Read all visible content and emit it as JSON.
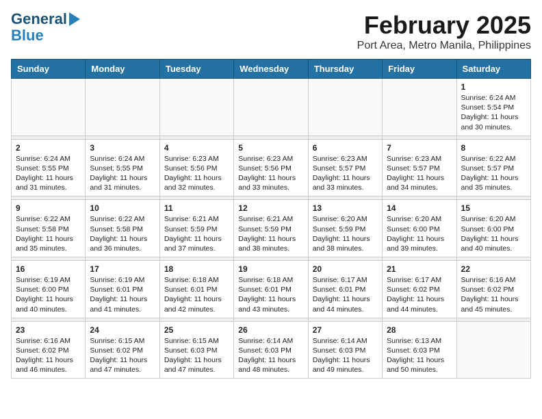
{
  "header": {
    "logo_line1": "General",
    "logo_line2": "Blue",
    "month": "February 2025",
    "location": "Port Area, Metro Manila, Philippines"
  },
  "days_of_week": [
    "Sunday",
    "Monday",
    "Tuesday",
    "Wednesday",
    "Thursday",
    "Friday",
    "Saturday"
  ],
  "weeks": [
    [
      {
        "day": "",
        "text": ""
      },
      {
        "day": "",
        "text": ""
      },
      {
        "day": "",
        "text": ""
      },
      {
        "day": "",
        "text": ""
      },
      {
        "day": "",
        "text": ""
      },
      {
        "day": "",
        "text": ""
      },
      {
        "day": "1",
        "text": "Sunrise: 6:24 AM\nSunset: 5:54 PM\nDaylight: 11 hours\nand 30 minutes."
      }
    ],
    [
      {
        "day": "2",
        "text": "Sunrise: 6:24 AM\nSunset: 5:55 PM\nDaylight: 11 hours\nand 31 minutes."
      },
      {
        "day": "3",
        "text": "Sunrise: 6:24 AM\nSunset: 5:55 PM\nDaylight: 11 hours\nand 31 minutes."
      },
      {
        "day": "4",
        "text": "Sunrise: 6:23 AM\nSunset: 5:56 PM\nDaylight: 11 hours\nand 32 minutes."
      },
      {
        "day": "5",
        "text": "Sunrise: 6:23 AM\nSunset: 5:56 PM\nDaylight: 11 hours\nand 33 minutes."
      },
      {
        "day": "6",
        "text": "Sunrise: 6:23 AM\nSunset: 5:57 PM\nDaylight: 11 hours\nand 33 minutes."
      },
      {
        "day": "7",
        "text": "Sunrise: 6:23 AM\nSunset: 5:57 PM\nDaylight: 11 hours\nand 34 minutes."
      },
      {
        "day": "8",
        "text": "Sunrise: 6:22 AM\nSunset: 5:57 PM\nDaylight: 11 hours\nand 35 minutes."
      }
    ],
    [
      {
        "day": "9",
        "text": "Sunrise: 6:22 AM\nSunset: 5:58 PM\nDaylight: 11 hours\nand 35 minutes."
      },
      {
        "day": "10",
        "text": "Sunrise: 6:22 AM\nSunset: 5:58 PM\nDaylight: 11 hours\nand 36 minutes."
      },
      {
        "day": "11",
        "text": "Sunrise: 6:21 AM\nSunset: 5:59 PM\nDaylight: 11 hours\nand 37 minutes."
      },
      {
        "day": "12",
        "text": "Sunrise: 6:21 AM\nSunset: 5:59 PM\nDaylight: 11 hours\nand 38 minutes."
      },
      {
        "day": "13",
        "text": "Sunrise: 6:20 AM\nSunset: 5:59 PM\nDaylight: 11 hours\nand 38 minutes."
      },
      {
        "day": "14",
        "text": "Sunrise: 6:20 AM\nSunset: 6:00 PM\nDaylight: 11 hours\nand 39 minutes."
      },
      {
        "day": "15",
        "text": "Sunrise: 6:20 AM\nSunset: 6:00 PM\nDaylight: 11 hours\nand 40 minutes."
      }
    ],
    [
      {
        "day": "16",
        "text": "Sunrise: 6:19 AM\nSunset: 6:00 PM\nDaylight: 11 hours\nand 40 minutes."
      },
      {
        "day": "17",
        "text": "Sunrise: 6:19 AM\nSunset: 6:01 PM\nDaylight: 11 hours\nand 41 minutes."
      },
      {
        "day": "18",
        "text": "Sunrise: 6:18 AM\nSunset: 6:01 PM\nDaylight: 11 hours\nand 42 minutes."
      },
      {
        "day": "19",
        "text": "Sunrise: 6:18 AM\nSunset: 6:01 PM\nDaylight: 11 hours\nand 43 minutes."
      },
      {
        "day": "20",
        "text": "Sunrise: 6:17 AM\nSunset: 6:01 PM\nDaylight: 11 hours\nand 44 minutes."
      },
      {
        "day": "21",
        "text": "Sunrise: 6:17 AM\nSunset: 6:02 PM\nDaylight: 11 hours\nand 44 minutes."
      },
      {
        "day": "22",
        "text": "Sunrise: 6:16 AM\nSunset: 6:02 PM\nDaylight: 11 hours\nand 45 minutes."
      }
    ],
    [
      {
        "day": "23",
        "text": "Sunrise: 6:16 AM\nSunset: 6:02 PM\nDaylight: 11 hours\nand 46 minutes."
      },
      {
        "day": "24",
        "text": "Sunrise: 6:15 AM\nSunset: 6:02 PM\nDaylight: 11 hours\nand 47 minutes."
      },
      {
        "day": "25",
        "text": "Sunrise: 6:15 AM\nSunset: 6:03 PM\nDaylight: 11 hours\nand 47 minutes."
      },
      {
        "day": "26",
        "text": "Sunrise: 6:14 AM\nSunset: 6:03 PM\nDaylight: 11 hours\nand 48 minutes."
      },
      {
        "day": "27",
        "text": "Sunrise: 6:14 AM\nSunset: 6:03 PM\nDaylight: 11 hours\nand 49 minutes."
      },
      {
        "day": "28",
        "text": "Sunrise: 6:13 AM\nSunset: 6:03 PM\nDaylight: 11 hours\nand 50 minutes."
      },
      {
        "day": "",
        "text": ""
      }
    ]
  ]
}
